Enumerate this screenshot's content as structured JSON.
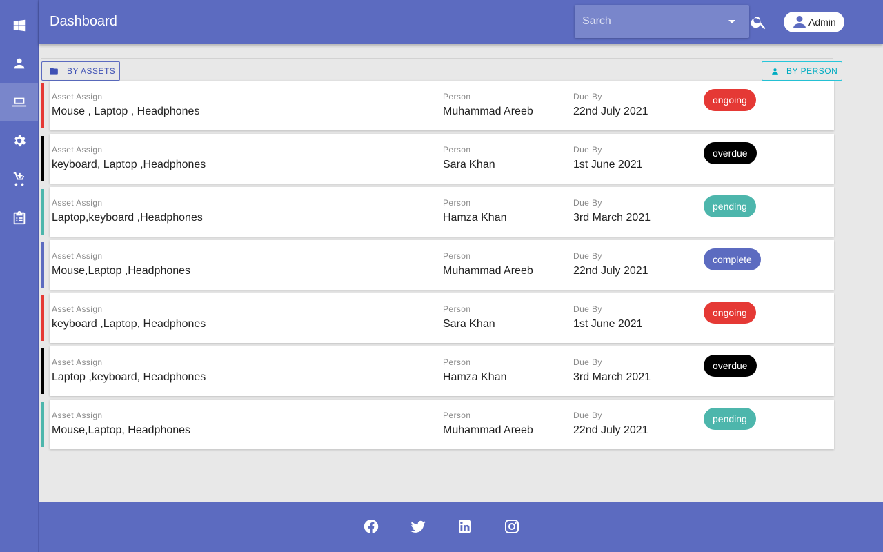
{
  "header": {
    "title": "Dashboard",
    "search_placeholder": "Sarch",
    "user_label": "Admin"
  },
  "sidebar": {
    "items": [
      {
        "icon": "windows-icon",
        "active": false
      },
      {
        "icon": "person-icon",
        "active": false
      },
      {
        "icon": "laptop-icon",
        "active": true
      },
      {
        "icon": "gear-icon",
        "active": false
      },
      {
        "icon": "cart-icon",
        "active": false
      },
      {
        "icon": "clipboard-icon",
        "active": false
      }
    ]
  },
  "tabs": {
    "by_assets": "BY ASSETS",
    "by_person": "BY PERSON"
  },
  "columns": {
    "asset": "Asset Assign",
    "person": "Person",
    "due": "Due By"
  },
  "status_colors": {
    "ongoing": "#e53935",
    "overdue": "#000000",
    "pending": "#4db6ac",
    "complete": "#5c6bc0"
  },
  "assignments": [
    {
      "assets": "Mouse , Laptop , Headphones",
      "person": "Muhammad Areeb",
      "due": "22nd July 2021",
      "status": "ongoing"
    },
    {
      "assets": "keyboard, Laptop ,Headphones",
      "person": "Sara Khan",
      "due": "1st June 2021",
      "status": "overdue"
    },
    {
      "assets": "Laptop,keyboard ,Headphones",
      "person": "Hamza Khan",
      "due": "3rd March 2021",
      "status": "pending"
    },
    {
      "assets": "Mouse,Laptop ,Headphones",
      "person": "Muhammad Areeb",
      "due": "22nd July 2021",
      "status": "complete"
    },
    {
      "assets": "keyboard ,Laptop, Headphones",
      "person": "Sara Khan",
      "due": "1st June 2021",
      "status": "ongoing"
    },
    {
      "assets": "Laptop ,keyboard, Headphones",
      "person": "Hamza Khan",
      "due": "3rd March 2021",
      "status": "overdue"
    },
    {
      "assets": "Mouse,Laptop, Headphones",
      "person": "Muhammad Areeb",
      "due": "22nd July 2021",
      "status": "pending"
    }
  ],
  "footer": {
    "social": [
      "facebook-icon",
      "twitter-icon",
      "linkedin-icon",
      "instagram-icon"
    ]
  }
}
